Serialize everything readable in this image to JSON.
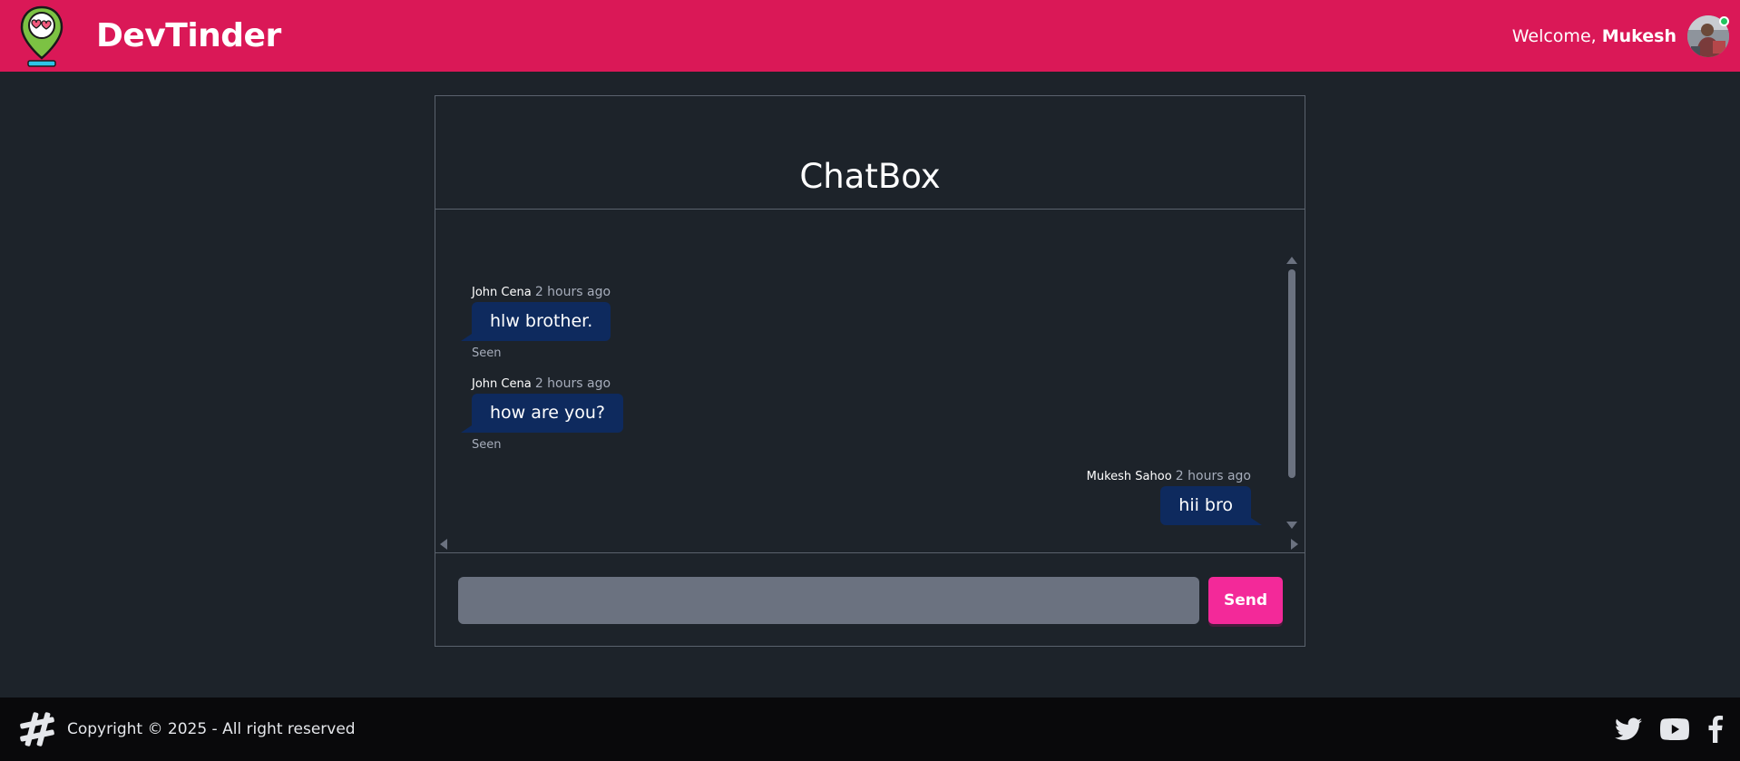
{
  "navbar": {
    "brand": "DevTinder",
    "welcome_prefix": "Welcome, ",
    "username": "Mukesh"
  },
  "chat": {
    "title": "ChatBox",
    "messages": [
      {
        "sender": "John Cena",
        "time": "2 hours ago",
        "text": "hlw brother.",
        "status": "Seen",
        "side": "left"
      },
      {
        "sender": "John Cena",
        "time": "2 hours ago",
        "text": "how are you?",
        "status": "Seen",
        "side": "left"
      },
      {
        "sender": "Mukesh Sahoo",
        "time": "2 hours ago",
        "text": "hii bro",
        "status": "",
        "side": "right"
      }
    ],
    "input": {
      "value": "",
      "placeholder": ""
    },
    "send_label": "Send"
  },
  "footer": {
    "copyright": "Copyright © 2025 - All right reserved",
    "social_icons": [
      "twitter-icon",
      "youtube-icon",
      "facebook-icon"
    ]
  },
  "colors": {
    "navbar": "#da1857",
    "background": "#1d232a",
    "bubble": "#0e2a5e",
    "send_button": "#f32999",
    "input": "#6b7280",
    "footer": "#09090b"
  }
}
